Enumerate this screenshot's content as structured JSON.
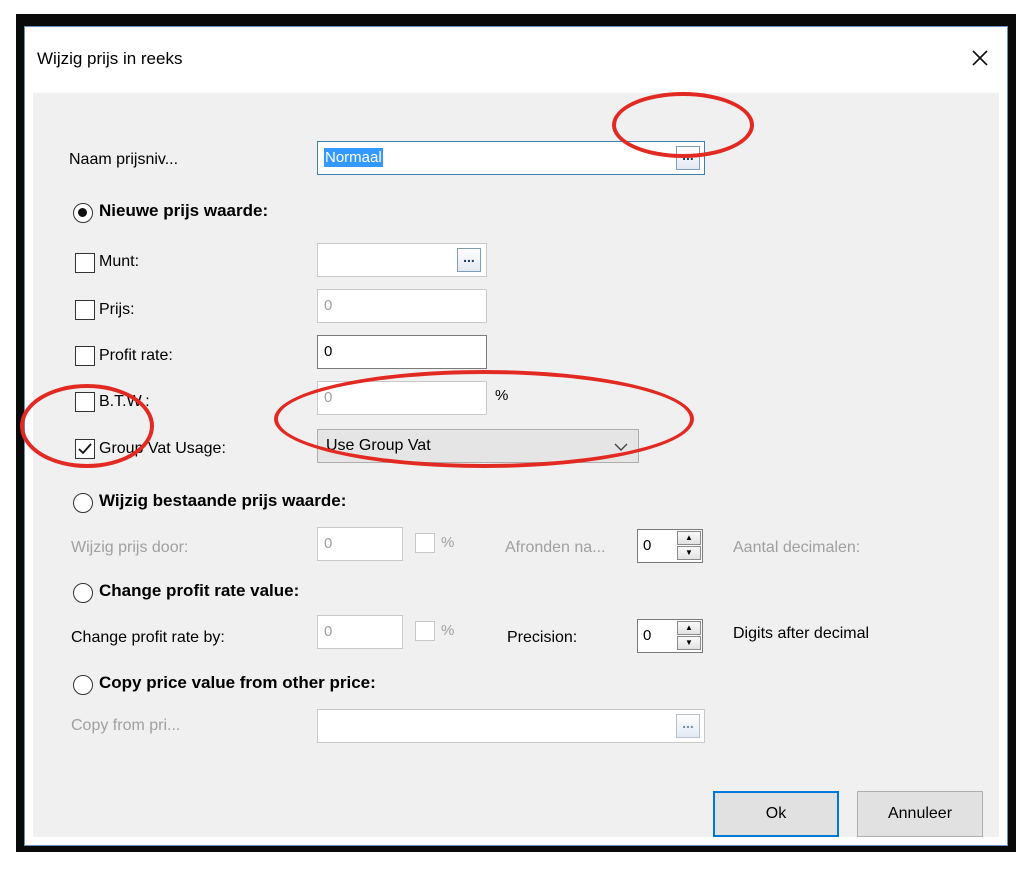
{
  "dialog": {
    "title": "Wijzig prijs in reeks",
    "close_glyph": "✕"
  },
  "naam": {
    "label": "Naam prijsniv...",
    "value": "Normaal",
    "ellipsis": "..."
  },
  "nieuwe_prijs": {
    "radio_label": "Nieuwe prijs waarde:",
    "selected": true,
    "munt": {
      "label": "Munt:",
      "value": "",
      "ellipsis": "...",
      "checked": false
    },
    "prijs": {
      "label": "Prijs:",
      "value": "0",
      "checked": false
    },
    "profit_rate": {
      "label": "Profit rate:",
      "value": "0",
      "checked": false
    },
    "btw": {
      "label": "B.T.W.:",
      "value": "0",
      "unit": "%",
      "checked": false
    },
    "group_vat": {
      "label": "Group Vat Usage:",
      "checked": true,
      "selected_option": "Use Group Vat"
    }
  },
  "wijzig_bestaande": {
    "radio_label": "Wijzig bestaande prijs waarde:",
    "selected": false,
    "row_label": "Wijzig prijs door:",
    "value": "0",
    "unit": "%",
    "afronden_label": "Afronden na...",
    "spin_value": "0",
    "decimals_label": "Aantal decimalen:"
  },
  "change_profit": {
    "radio_label": "Change profit rate value:",
    "selected": false,
    "row_label": "Change profit rate by:",
    "value": "0",
    "unit": "%",
    "precision_label": "Precision:",
    "spin_value": "0",
    "digits_label": "Digits after decimal"
  },
  "copy_price": {
    "radio_label": "Copy price value from other price:",
    "selected": false,
    "row_label": "Copy from pri...",
    "value": "",
    "ellipsis": "..."
  },
  "buttons": {
    "ok": "Ok",
    "cancel": "Annuleer"
  },
  "annotation_color": "#e22a22"
}
